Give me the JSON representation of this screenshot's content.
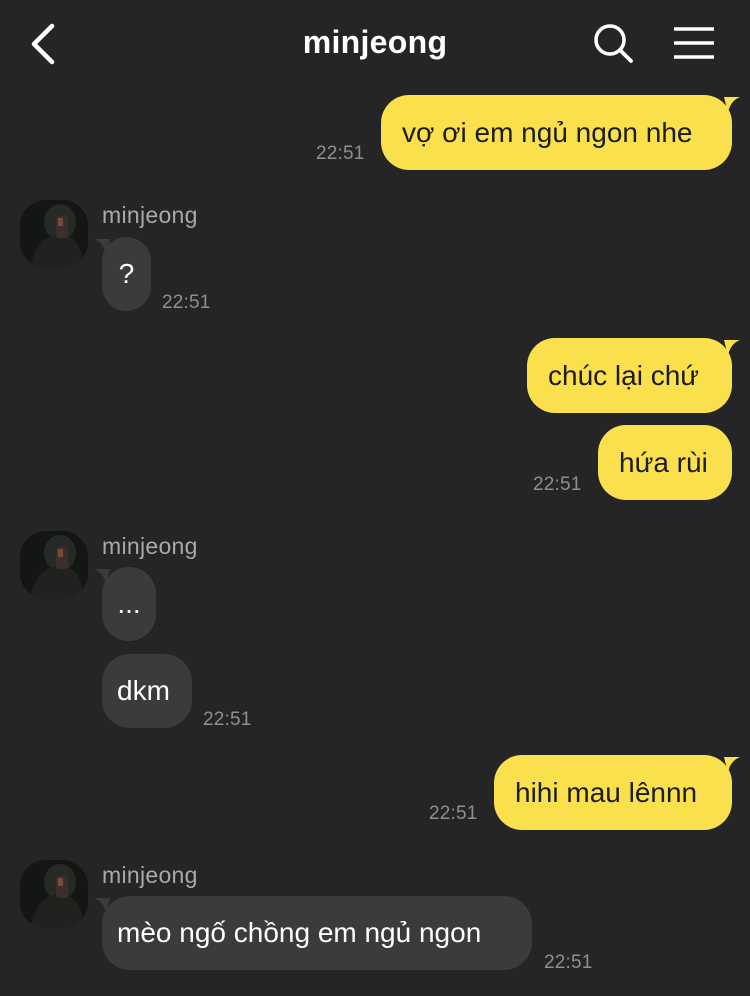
{
  "header": {
    "title": "minjeong",
    "back_icon": "chevron-left-icon",
    "search_icon": "search-icon",
    "menu_icon": "hamburger-menu-icon"
  },
  "colors": {
    "background": "#252527",
    "outgoing_bubble": "#f9e04c",
    "incoming_bubble": "#3b3b3d",
    "timestamp": "#8f8f92"
  },
  "messages": [
    {
      "direction": "out",
      "text": "vợ ơi em ngủ ngon nhe",
      "time": "22:51"
    },
    {
      "direction": "in",
      "sender": "minjeong",
      "text": "?",
      "time": "22:51"
    },
    {
      "direction": "out",
      "text": "chúc lại chứ"
    },
    {
      "direction": "out",
      "text": "hứa rùi",
      "time": "22:51"
    },
    {
      "direction": "in",
      "sender": "minjeong",
      "text": "..."
    },
    {
      "direction": "in",
      "text": "dkm",
      "time": "22:51"
    },
    {
      "direction": "out",
      "text": "hihi mau lênnn",
      "time": "22:51"
    },
    {
      "direction": "in",
      "sender": "minjeong",
      "text": "mèo ngố chồng em ngủ ngon",
      "time": "22:51"
    }
  ]
}
